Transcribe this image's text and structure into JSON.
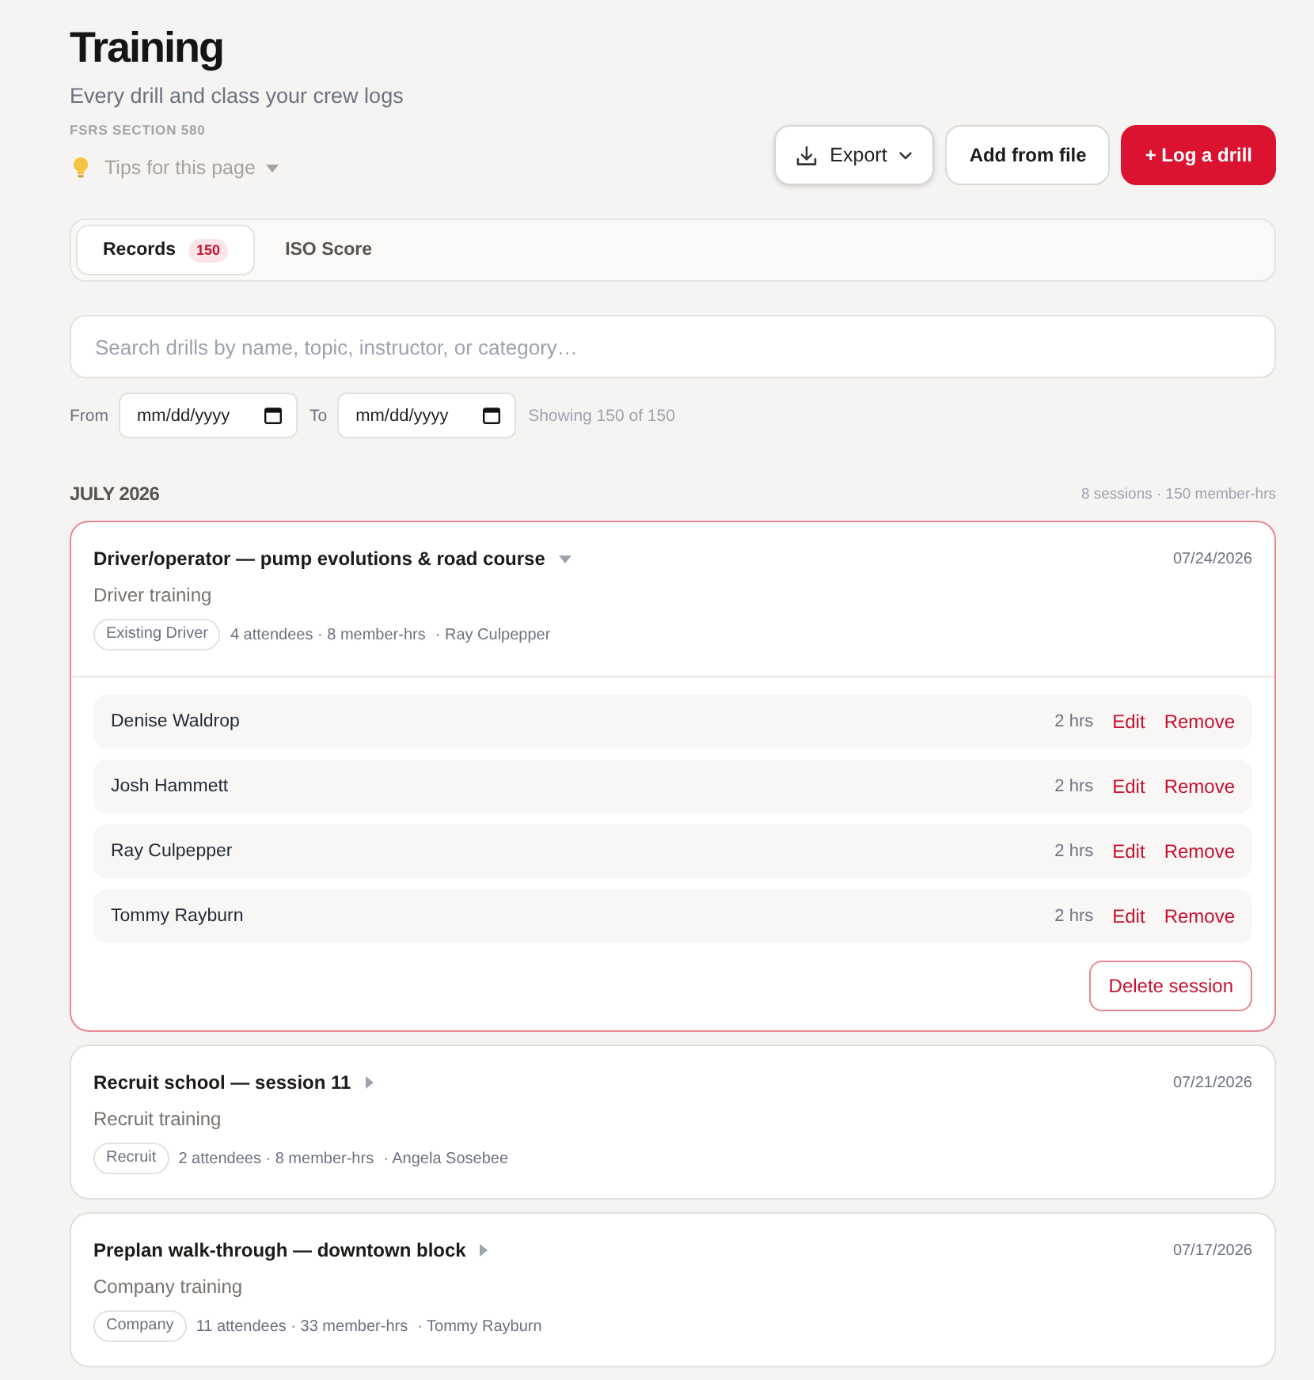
{
  "header": {
    "title": "Training",
    "subtitle": "Every drill and class your crew logs",
    "section": "FSRS SECTION 580",
    "tips": {
      "label": "Tips for this page",
      "expanded": false
    }
  },
  "actions": [
    {
      "label": "Export",
      "kind": "menu"
    },
    {
      "label": "Add from file",
      "kind": "secondary"
    },
    {
      "label": "+ Log a drill",
      "kind": "primary"
    }
  ],
  "tabs": [
    {
      "label": "Records",
      "badge": "150",
      "selected": true
    },
    {
      "label": "ISO Score",
      "selected": false
    }
  ],
  "search": {
    "placeholder": "Search drills by name, topic, instructor, or category…"
  },
  "filters": {
    "from": {
      "label": "From",
      "placeholder": "mm/dd/yyyy"
    },
    "to": {
      "label": "To",
      "placeholder": "mm/dd/yyyy"
    },
    "summary": "Showing 150 of 150"
  },
  "groups": [
    {
      "month": "JULY 2026",
      "summary": "8 sessions · 150 member-hrs",
      "sessions": [
        {
          "title": "Driver/operator — pump evolutions & road course",
          "date": "07/24/2026",
          "category": "Driver training",
          "tag": "Existing Driver",
          "stats": "4 attendees · 8 member-hrs",
          "instructor": "· Ray Culpepper",
          "expanded": true,
          "attendees": [
            {
              "name": "Denise Waldrop",
              "hours": "2 hrs",
              "actions": [
                "Edit",
                "Remove"
              ]
            },
            {
              "name": "Josh Hammett",
              "hours": "2 hrs",
              "actions": [
                "Edit",
                "Remove"
              ]
            },
            {
              "name": "Ray Culpepper",
              "hours": "2 hrs",
              "actions": [
                "Edit",
                "Remove"
              ]
            },
            {
              "name": "Tommy Rayburn",
              "hours": "2 hrs",
              "actions": [
                "Edit",
                "Remove"
              ]
            }
          ],
          "delete_label": "Delete session"
        },
        {
          "title": "Recruit school — session 11",
          "date": "07/21/2026",
          "category": "Recruit training",
          "tag": "Recruit",
          "stats": "2 attendees · 8 member-hrs",
          "instructor": "· Angela Sosebee",
          "expanded": false
        },
        {
          "title": "Preplan walk-through — downtown block",
          "date": "07/17/2026",
          "category": "Company training",
          "tag": "Company",
          "stats": "11 attendees · 33 member-hrs",
          "instructor": "· Tommy Rayburn",
          "expanded": false
        }
      ]
    }
  ]
}
